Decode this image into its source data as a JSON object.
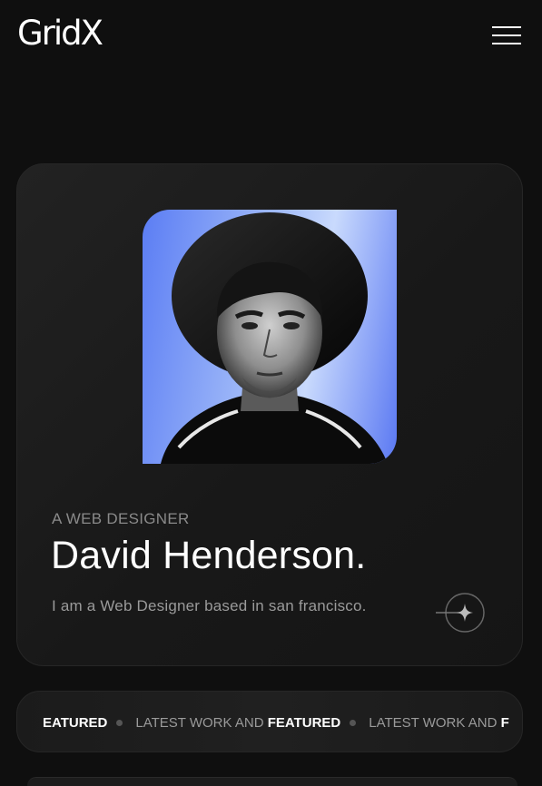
{
  "header": {
    "logo": "GridX",
    "menu_icon": "hamburger-menu-icon"
  },
  "profile": {
    "subtitle": "A WEB DESIGNER",
    "name": "David Henderson.",
    "bio": "I am a Web Designer based in san francisco.",
    "action_icon": "sparkle-arrow-icon",
    "portrait_alt": "portrait"
  },
  "ticker": {
    "items": [
      {
        "text": "EATURED",
        "strong": true
      },
      {
        "text": "LATEST WORK AND",
        "strong": false
      },
      {
        "text": "FEATURED",
        "strong": true
      },
      {
        "text": "LATEST WORK AND",
        "strong": false
      },
      {
        "text": "F",
        "strong": true
      }
    ]
  },
  "colors": {
    "background": "#0f0f0f",
    "card": "#1c1c1c",
    "portrait_blue": "#5b7df4",
    "text_primary": "#ffffff",
    "text_muted": "#8a8a8a"
  }
}
